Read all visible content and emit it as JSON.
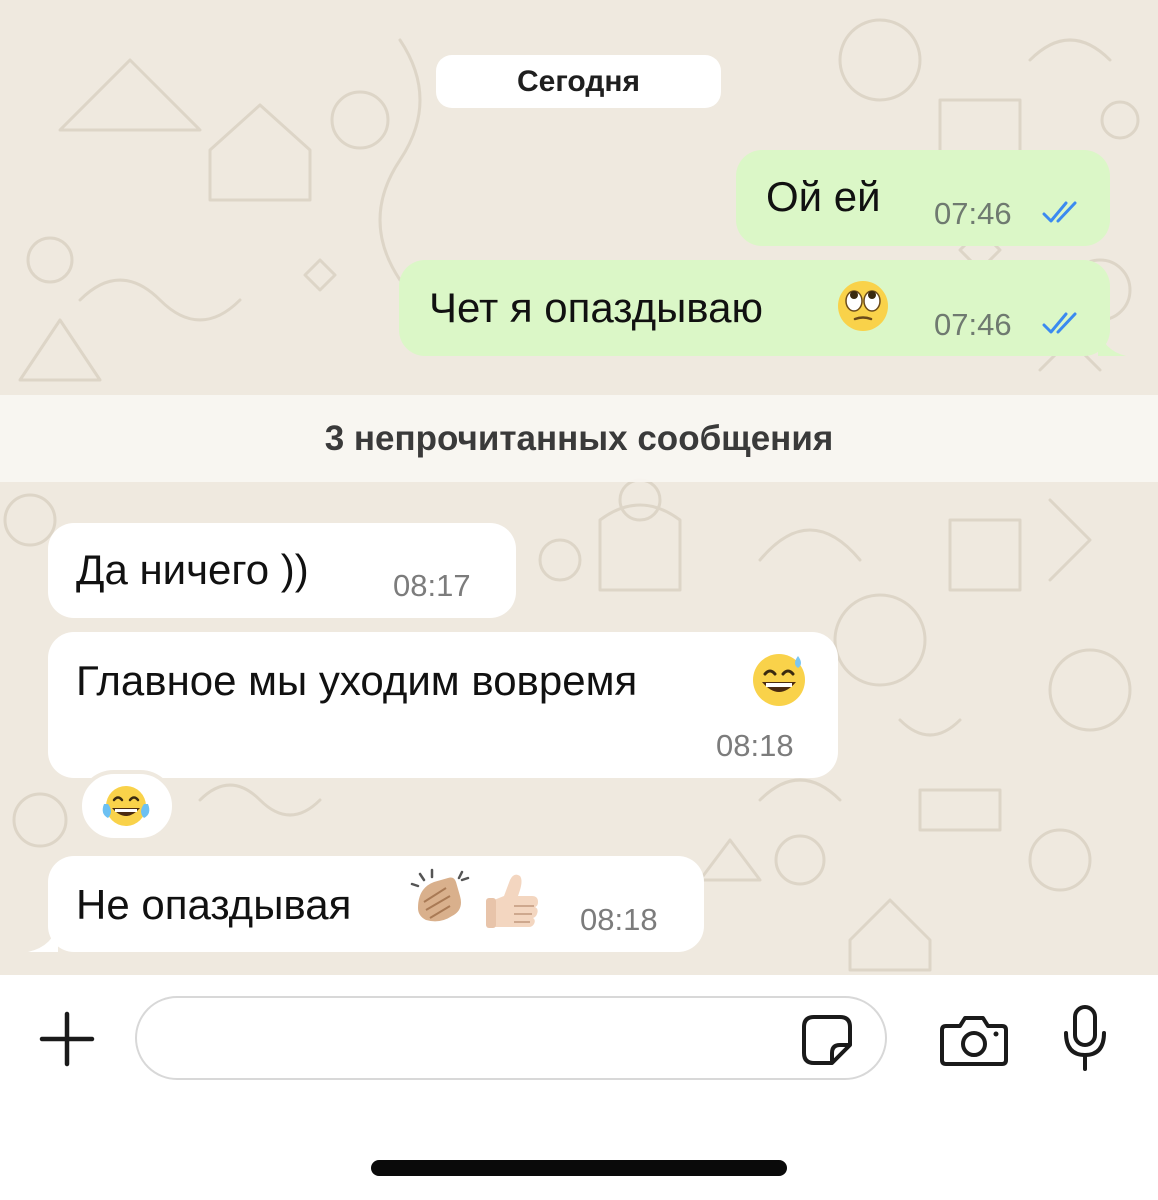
{
  "chat": {
    "date_label": "Сегодня",
    "unread_label": "3 непрочитанных сообщения",
    "messages": [
      {
        "text": "Ой ей",
        "time": "07:46",
        "status": "read-double-check",
        "direction": "outgoing"
      },
      {
        "text": "Чет я опаздываю",
        "emoji": "eye-roll-emoji",
        "time": "07:46",
        "status": "read-double-check",
        "direction": "outgoing"
      },
      {
        "text": "Да ничего ))",
        "time": "08:17",
        "direction": "incoming"
      },
      {
        "text": "Главное мы уходим вовремя",
        "emoji": "sweat-smile-emoji",
        "time": "08:18",
        "direction": "incoming"
      },
      {
        "reaction": "tears-of-joy-emoji",
        "direction": "incoming"
      },
      {
        "text": "Не опаздывая",
        "emoji": "clapping-hands-thumbs-up-emoji",
        "time": "08:18",
        "direction": "incoming"
      }
    ]
  },
  "input": {
    "placeholder": "",
    "value": ""
  },
  "colors": {
    "wallpaper": "#efe9df",
    "outgoing_bubble": "#dbf7c7",
    "incoming_bubble": "#ffffff",
    "read_check": "#3b8af0"
  },
  "icons": [
    "plus-icon",
    "sticker-icon",
    "camera-icon",
    "microphone-icon",
    "double-check-icon"
  ]
}
